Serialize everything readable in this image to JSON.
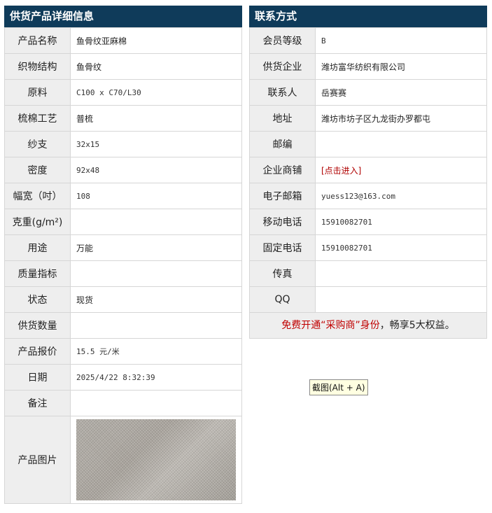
{
  "left": {
    "title": "供货产品详细信息",
    "rows": [
      {
        "label": "产品名称",
        "value": "鱼骨纹亚麻棉"
      },
      {
        "label": "织物结构",
        "value": "鱼骨纹"
      },
      {
        "label": "原料",
        "value": "C100 x C70/L30"
      },
      {
        "label": "梳棉工艺",
        "value": "普梳"
      },
      {
        "label": "纱支",
        "value": "32x15"
      },
      {
        "label": "密度",
        "value": "92x48"
      },
      {
        "label": "幅宽（吋）",
        "value": "108"
      },
      {
        "label": "克重(g/m²)",
        "value": ""
      },
      {
        "label": "用途",
        "value": "万能"
      },
      {
        "label": "质量指标",
        "value": ""
      },
      {
        "label": "状态",
        "value": "现货"
      },
      {
        "label": "供货数量",
        "value": ""
      },
      {
        "label": "产品报价",
        "value": "15.5 元/米"
      },
      {
        "label": "日期",
        "value": "2025/4/22 8:32:39"
      },
      {
        "label": "备注",
        "value": ""
      },
      {
        "label": "产品图片",
        "value": ""
      }
    ]
  },
  "right": {
    "title": "联系方式",
    "rows": [
      {
        "label": "会员等级",
        "value": "B"
      },
      {
        "label": "供货企业",
        "value": "潍坊富华纺织有限公司"
      },
      {
        "label": "联系人",
        "value": "岳赛赛"
      },
      {
        "label": "地址",
        "value": "潍坊市坊子区九龙街办罗都屯"
      },
      {
        "label": "邮编",
        "value": ""
      },
      {
        "label": "企业商铺",
        "value": "[点击进入]"
      },
      {
        "label": "电子邮箱",
        "value": "yuess123@163.com"
      },
      {
        "label": "移动电话",
        "value": "15910082701"
      },
      {
        "label": "固定电话",
        "value": "15910082701"
      },
      {
        "label": "传真",
        "value": ""
      },
      {
        "label": "QQ",
        "value": ""
      }
    ],
    "promo": {
      "part1": "免费开通“采购商”身份",
      "part2": "，畅享5大权益。"
    }
  },
  "tooltip": "截图(Alt + A)"
}
